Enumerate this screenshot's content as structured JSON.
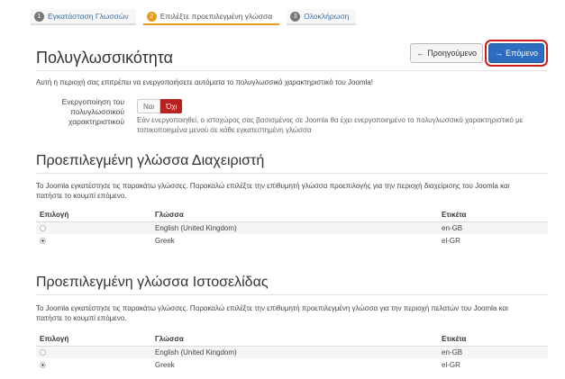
{
  "steps": [
    {
      "num": "1",
      "label": "Εγκατάσταση Γλωσσών"
    },
    {
      "num": "2",
      "label": "Επιλέξτε προεπιλεγμένη γλώσσα"
    },
    {
      "num": "3",
      "label": "Ολοκλήρωση"
    }
  ],
  "header": {
    "title": "Πολυγλωσσικότητα",
    "prev_label": "Προηγούμενο",
    "next_label": "Επόμενο"
  },
  "multilang": {
    "intro": "Αυτή η περιοχή σας επιτρέπει να ενεργοποιήσετε αυτόματα το πολυγλωσσικό χαρακτηριστικό του Joomla!",
    "field_label": "Ενεργοποίηση του πολυγλωσσικού χαρακτηριστικού",
    "yes": "Ναι",
    "no": "Όχι",
    "help": "Εάν ενεργοποιηθεί, ο ιστοχώρος σας βασισμένος σε Joomla θα έχει ενεργοποιημένο το πολυγλωσσικό χαρακτηριστικό με τοπικοποιημένα μενού σε κάθε εγκατεστημένη γλώσσα"
  },
  "admin": {
    "title": "Προεπιλεγμένη γλώσσα Διαχειριστή",
    "desc": "Το Joomla εγκατέστησε τις παρακάτω γλώσσες. Παρακαλώ επιλέξτε την επιθυμητή γλώσσα προεπιλογής για την περιοχή διαχείρισης του Joomla και πατήστε το κουμπί επόμενο.",
    "columns": [
      "Επιλογή",
      "Γλώσσα",
      "Ετικέτα"
    ],
    "rows": [
      {
        "language": "English (United Kingdom)",
        "tag": "en-GB",
        "selected": false
      },
      {
        "language": "Greek",
        "tag": "el-GR",
        "selected": true
      }
    ]
  },
  "site": {
    "title": "Προεπιλεγμένη γλώσσα Ιστοσελίδας",
    "desc": "Το Joomla εγκατέστησε τις παρακάτω γλώσσες. Παρακαλώ επιλέξτε την επιθυμητή προεπιλεγμένη γλώσσα για την περιοχή πελατών του Joomla και πατήστε το κουμπί επόμενο.",
    "columns": [
      "Επιλογή",
      "Γλώσσα",
      "Ετικέτα"
    ],
    "rows": [
      {
        "language": "English (United Kingdom)",
        "tag": "en-GB",
        "selected": false
      },
      {
        "language": "Greek",
        "tag": "el-GR",
        "selected": true
      }
    ]
  },
  "colors": {
    "accent": "#2c6dbf",
    "highlight": "#d01b1b",
    "step_active": "#e59b1c",
    "toggle_no": "#b7221f"
  }
}
